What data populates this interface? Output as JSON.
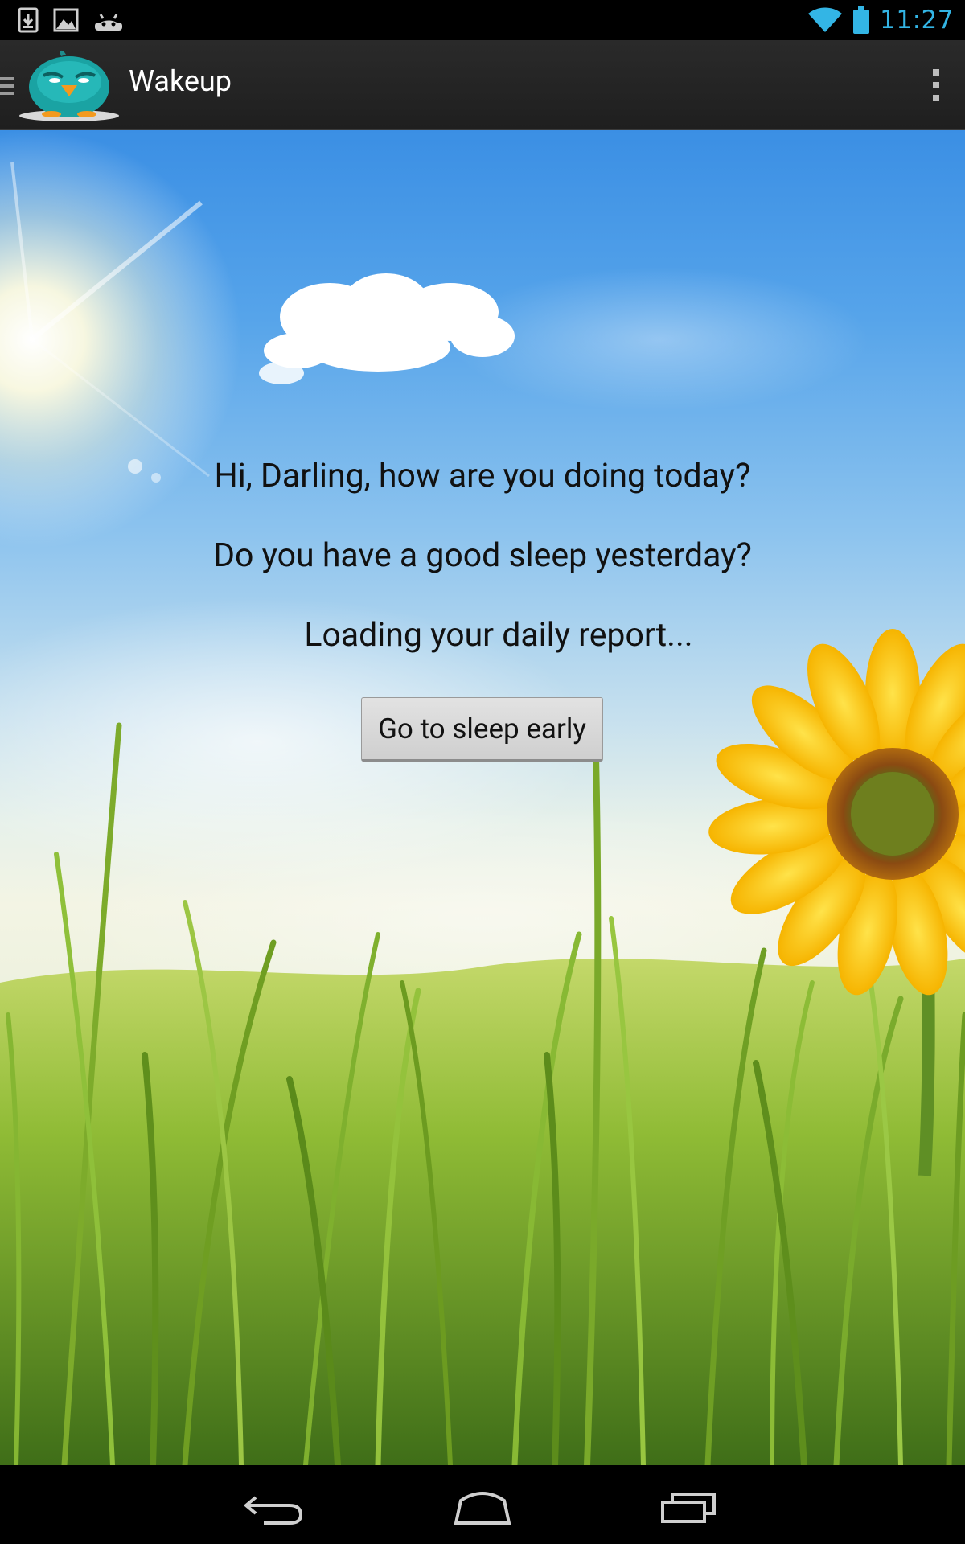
{
  "status_bar": {
    "time": "11:27",
    "notification_icons": [
      "download-icon",
      "image-icon",
      "android-icon"
    ],
    "system_icons": [
      "wifi-icon",
      "battery-icon"
    ],
    "accent_color": "#33b5e5"
  },
  "action_bar": {
    "title": "Wakeup",
    "icons": [
      "drawer-icon",
      "bird-logo-icon",
      "overflow-menu-icon"
    ]
  },
  "main": {
    "greeting": "Hi, Darling, how are you doing today?",
    "question": "Do you have a good sleep yesterday?",
    "status": "Loading your daily report...",
    "button_label": "Go to sleep early"
  },
  "nav_bar": {
    "icons": [
      "back-icon",
      "home-icon",
      "recent-apps-icon"
    ]
  }
}
